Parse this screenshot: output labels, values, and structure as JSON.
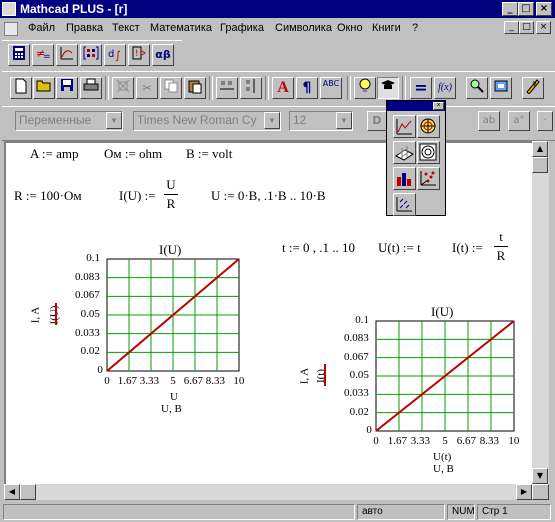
{
  "window": {
    "title": "Mathcad PLUS - [r]",
    "minimize": "_",
    "maximize": "□",
    "close": "×"
  },
  "menu": [
    "Файл",
    "Правка",
    "Текст",
    "Математика",
    "Графика",
    "Символика",
    "Окно",
    "Книги",
    "?"
  ],
  "mdi": {
    "minimize": "_",
    "restore": "□",
    "close": "×"
  },
  "toolbar1": {
    "alpha_beta": "αβ"
  },
  "toolbar2": {
    "text_a": "A",
    "pilcrow": "¶",
    "spell": "ABC",
    "equals": "=",
    "fx": "f(x)"
  },
  "format_bar": {
    "style": "Переменные",
    "font": "Times New Roman Cy",
    "size": "12",
    "btn_d": "D",
    "btn_ab": "ab",
    "btn_a0": "a°"
  },
  "worksheet": {
    "units": {
      "a": "A := amp",
      "om": "Ом := ohm",
      "b": "B := volt"
    },
    "r_def": "R := 100·Ом",
    "i_of_u": {
      "lhs": "I(U) :=",
      "num": "U",
      "den": "R"
    },
    "u_range": "U := 0·B, .1·B .. 10·B",
    "t_range": "t := 0 , .1 .. 10",
    "u_of_t": "U(t) := t",
    "i_of_t": {
      "lhs": "I(t) :=",
      "num": "t",
      "den": "R"
    }
  },
  "plot1": {
    "title": "I(U)",
    "y_ticks": [
      "0.1",
      "0.083",
      "0.067",
      "0.05",
      "0.033",
      "0.02",
      "0"
    ],
    "x_ticks": [
      "0",
      "1.67",
      "3.33",
      "5",
      "6.67",
      "8.33",
      "10"
    ],
    "ylabel_outer": "I, A",
    "ylabel_inner": "I(U)",
    "xlabel_inner": "U",
    "xlabel_outer": "U, B"
  },
  "plot2": {
    "title": "I(U)",
    "y_ticks": [
      "0.1",
      "0.083",
      "0.067",
      "0.05",
      "0.033",
      "0.02",
      "0"
    ],
    "x_ticks": [
      "0",
      "1.67",
      "3.33",
      "5",
      "6.67",
      "8.33",
      "10"
    ],
    "ylabel_outer": "I, A",
    "ylabel_inner": "I(t)",
    "xlabel_inner": "U(t)",
    "xlabel_outer": "U, B"
  },
  "chart_data": [
    {
      "type": "line",
      "title": "I(U)",
      "xlabel": "U, B",
      "ylabel": "I, A",
      "xlim": [
        0,
        10
      ],
      "ylim": [
        0,
        0.1
      ],
      "grid": true,
      "series": [
        {
          "name": "I(U)",
          "x": [
            0,
            10
          ],
          "y": [
            0,
            0.1
          ],
          "color": "#c00000"
        }
      ]
    },
    {
      "type": "line",
      "title": "I(U)",
      "xlabel": "U, B",
      "ylabel": "I, A",
      "xlim": [
        0,
        10
      ],
      "ylim": [
        0,
        0.1
      ],
      "grid": true,
      "series": [
        {
          "name": "I(t)",
          "x": [
            0,
            10
          ],
          "y": [
            0,
            0.1
          ],
          "color": "#c00000"
        }
      ]
    }
  ],
  "status": {
    "mode": "авто",
    "num": "NUM",
    "page": "Стр 1"
  },
  "colors": {
    "titlebar": "#000080",
    "grid": "#00a000",
    "trace": "#c00000",
    "chrome": "#c0c0c0"
  }
}
